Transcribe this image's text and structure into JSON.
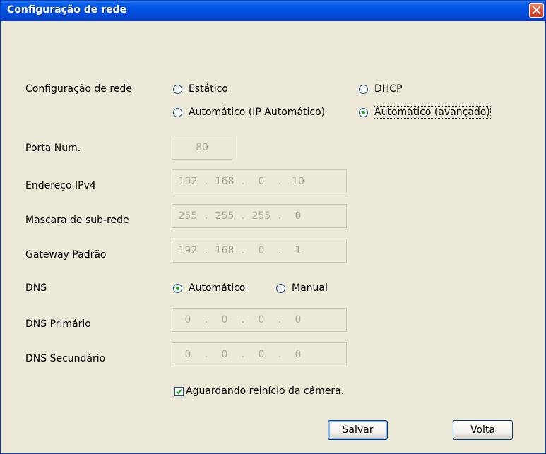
{
  "window": {
    "title": "Configuração de rede"
  },
  "network_config": {
    "label": "Configuração de rede",
    "options": [
      "Estático",
      "DHCP",
      "Automático (IP Automático)",
      "Automático (avançado)"
    ],
    "selected": "Automático (avançado)"
  },
  "port": {
    "label": "Porta Num.",
    "value": "80"
  },
  "ipv4": {
    "label": "Endereço IPv4",
    "octets": [
      "192",
      "168",
      "0",
      "10"
    ]
  },
  "subnet": {
    "label": "Mascara de sub-rede",
    "octets": [
      "255",
      "255",
      "255",
      "0"
    ]
  },
  "gateway": {
    "label": "Gateway Padrão",
    "octets": [
      "192",
      "168",
      "0",
      "1"
    ]
  },
  "dns": {
    "label": "DNS",
    "options": [
      "Automático",
      "Manual"
    ],
    "selected": "Automático"
  },
  "dns_primary": {
    "label": "DNS Primário",
    "octets": [
      "0",
      "0",
      "0",
      "0"
    ]
  },
  "dns_secondary": {
    "label": "DNS Secundário",
    "octets": [
      "0",
      "0",
      "0",
      "0"
    ]
  },
  "restart_checkbox": {
    "label": "Aguardando reinício da câmera.",
    "checked": true
  },
  "buttons": {
    "save": "Salvar",
    "back": "Volta"
  },
  "colors": {
    "titlebar": "#0054e3",
    "dialog_bg": "#ece9d8",
    "radio_selected": "#21a121",
    "disabled_text": "#aca899"
  }
}
